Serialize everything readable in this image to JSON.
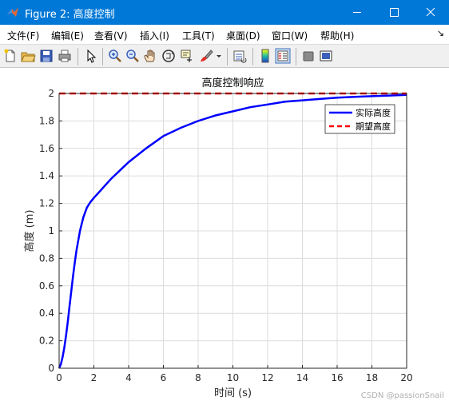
{
  "window": {
    "title": "Figure 2: 高度控制",
    "controls": [
      "minimize",
      "maximize",
      "close"
    ]
  },
  "menu": [
    "文件(F)",
    "编辑(E)",
    "查看(V)",
    "插入(I)",
    "工具(T)",
    "桌面(D)",
    "窗口(W)",
    "帮助(H)"
  ],
  "menu_overflow": "↘",
  "toolbar": [
    "new-figure-icon",
    "open-folder-icon",
    "save-icon",
    "print-icon",
    "pointer-icon",
    "zoom-in-icon",
    "zoom-out-icon",
    "pan-hand-icon",
    "rotate-3d-icon",
    "data-cursor-icon",
    "brush-icon",
    "link-plot-icon",
    "colorbar-icon",
    "legend-icon",
    "hide-plot-tools-icon",
    "show-plot-tools-icon"
  ],
  "colors": {
    "titlebar": "#0078d7",
    "actual": "#0000ff",
    "desired": "#ff0000"
  },
  "watermark": "CSDN @passionSnail",
  "chart_data": {
    "type": "line",
    "title": "高度控制响应",
    "xlabel": "时间 (s)",
    "ylabel": "高度 (m)",
    "xlim": [
      0,
      20
    ],
    "ylim": [
      0,
      2
    ],
    "xticks": [
      "0",
      "2",
      "4",
      "6",
      "8",
      "10",
      "12",
      "14",
      "16",
      "18",
      "20"
    ],
    "yticks": [
      "0",
      "0.2",
      "0.4",
      "0.6",
      "0.8",
      "1",
      "1.2",
      "1.4",
      "1.6",
      "1.8",
      "2"
    ],
    "grid": true,
    "legend_position": "top-right",
    "series": [
      {
        "name": "实际高度",
        "style": "solid",
        "color": "#0000ff",
        "x": [
          0,
          0.1,
          0.2,
          0.3,
          0.4,
          0.5,
          0.6,
          0.7,
          0.8,
          0.9,
          1.0,
          1.2,
          1.4,
          1.6,
          1.8,
          2.0,
          2.5,
          3.0,
          3.5,
          4.0,
          5.0,
          6.0,
          7.0,
          8.0,
          9.0,
          10.0,
          11.0,
          12.0,
          13.0,
          14.0,
          15.0,
          16.0,
          17.0,
          18.0,
          19.0,
          20.0
        ],
        "y": [
          0,
          0.03,
          0.08,
          0.15,
          0.24,
          0.34,
          0.45,
          0.56,
          0.67,
          0.77,
          0.86,
          1.0,
          1.1,
          1.17,
          1.21,
          1.24,
          1.31,
          1.38,
          1.44,
          1.5,
          1.6,
          1.69,
          1.75,
          1.8,
          1.84,
          1.87,
          1.9,
          1.92,
          1.94,
          1.95,
          1.96,
          1.97,
          1.975,
          1.98,
          1.985,
          1.99
        ]
      },
      {
        "name": "期望高度",
        "style": "dashed",
        "color": "#ff0000",
        "x": [
          0,
          20
        ],
        "y": [
          2,
          2
        ]
      }
    ]
  }
}
